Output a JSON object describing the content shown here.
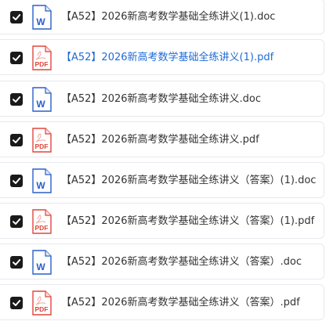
{
  "files": [
    {
      "name": "【A52】2026新高考数学基础全练讲义(1).doc",
      "type": "doc",
      "icon": "word-doc-icon",
      "checked": true,
      "highlighted": false
    },
    {
      "name": "【A52】2026新高考数学基础全练讲义(1).pdf",
      "type": "pdf",
      "icon": "pdf-file-icon",
      "checked": true,
      "highlighted": true
    },
    {
      "name": "【A52】2026新高考数学基础全练讲义.doc",
      "type": "doc",
      "icon": "word-doc-icon",
      "checked": true,
      "highlighted": false
    },
    {
      "name": "【A52】2026新高考数学基础全练讲义.pdf",
      "type": "pdf",
      "icon": "pdf-file-icon",
      "checked": true,
      "highlighted": false
    },
    {
      "name": "【A52】2026新高考数学基础全练讲义（答案）(1).doc",
      "type": "doc",
      "icon": "word-doc-icon",
      "checked": true,
      "highlighted": false
    },
    {
      "name": "【A52】2026新高考数学基础全练讲义（答案）(1).pdf",
      "type": "pdf",
      "icon": "pdf-file-icon",
      "checked": true,
      "highlighted": false
    },
    {
      "name": "【A52】2026新高考数学基础全练讲义（答案）.doc",
      "type": "doc",
      "icon": "word-doc-icon",
      "checked": true,
      "highlighted": false
    },
    {
      "name": "【A52】2026新高考数学基础全练讲义（答案）.pdf",
      "type": "pdf",
      "icon": "pdf-file-icon",
      "checked": true,
      "highlighted": false
    }
  ],
  "icon_labels": {
    "doc": "W",
    "pdf": "PDF"
  },
  "colors": {
    "word_blue": "#2b5fc9",
    "pdf_red": "#e0463c",
    "checkbox": "#1a1a1a",
    "link": "#1f6bd6",
    "text": "#333333",
    "row_border": "#e6e9ee"
  }
}
